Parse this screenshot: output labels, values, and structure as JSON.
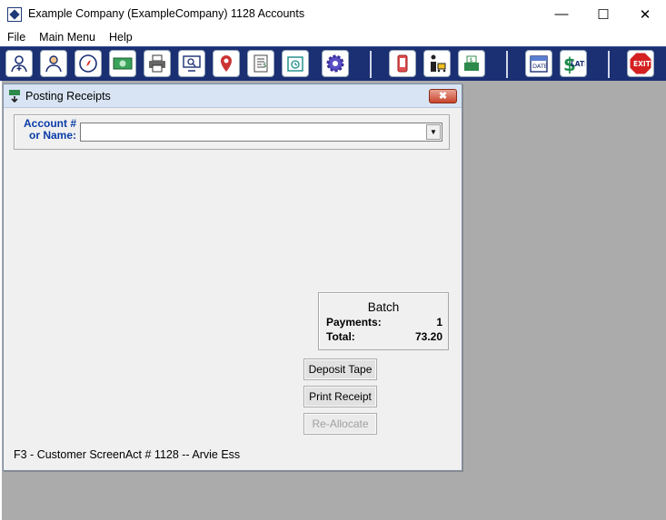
{
  "window": {
    "title": "Example Company (ExampleCompany)  1128 Accounts",
    "minimize_glyph": "—",
    "maximize_glyph": "☐",
    "close_glyph": "✕"
  },
  "menu": [
    {
      "label": "File"
    },
    {
      "label": "Main Menu"
    },
    {
      "label": "Help"
    }
  ],
  "toolbar": {
    "background": "#1b2f73",
    "buttons": [
      {
        "icon": "user-add-icon"
      },
      {
        "icon": "user-profile-icon"
      },
      {
        "icon": "compass-icon"
      },
      {
        "icon": "money-icon"
      },
      {
        "icon": "printer-icon"
      },
      {
        "icon": "monitor-search-icon"
      },
      {
        "icon": "location-pin-icon"
      },
      {
        "icon": "document-dollar-icon"
      },
      {
        "icon": "calendar-clock-icon"
      },
      {
        "icon": "gear-icon"
      },
      {
        "icon": "phone-icon"
      },
      {
        "icon": "person-cart-icon"
      },
      {
        "icon": "cash-register-icon"
      },
      {
        "icon": "date-calendar-icon"
      },
      {
        "icon": "late-dollar-icon"
      },
      {
        "icon": "exit-sign-icon"
      }
    ],
    "date_label": "DATE",
    "late_label": "LATE",
    "exit_label": "EXIT"
  },
  "dialog": {
    "title": "Posting Receipts",
    "close_glyph": "✖",
    "account_label_line1": "Account #",
    "account_label_line2": "or Name:",
    "account_value": "",
    "batch": {
      "title": "Batch",
      "payments_label": "Payments:",
      "payments_value": "1",
      "total_label": "Total:",
      "total_value": "73.20"
    },
    "buttons": {
      "deposit_tape": "Deposit Tape",
      "print_receipt": "Print Receipt",
      "re_allocate": "Re-Allocate"
    },
    "status": "F3 - Customer ScreenAct # 1128 -- Arvie Ess"
  },
  "colors": {
    "accent_blue": "#0a3ca8",
    "desktop_gray": "#ababab"
  }
}
